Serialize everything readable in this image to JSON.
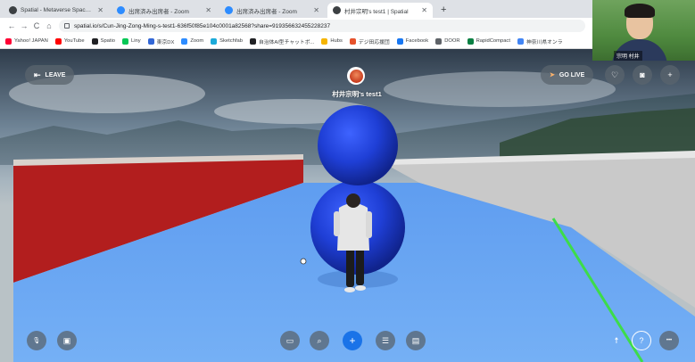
{
  "browser": {
    "tabs": [
      {
        "title": "Spatial - Metaverse Spaces That",
        "favicon_color": "#3c4043"
      },
      {
        "title": "出席済み出席者 - Zoom",
        "favicon_color": "#2d8cff"
      },
      {
        "title": "出席済み出席者 - Zoom",
        "favicon_color": "#2d8cff"
      },
      {
        "title": "村井宗明's test1 | Spatial",
        "favicon_color": "#3c4043",
        "active": true
      }
    ],
    "new_tab_label": "+",
    "url": "spatial.io/s/Cun-Jing-Zong-Ming-s-test1-636f50f85e104c0001a82568?share=919356632455228237",
    "bookmarks": [
      {
        "label": "Yahoo! JAPAN",
        "color": "#ff0033"
      },
      {
        "label": "YouTube",
        "color": "#ff0000"
      },
      {
        "label": "Spatio",
        "color": "#202124"
      },
      {
        "label": "Liny",
        "color": "#06c755"
      },
      {
        "label": "東京DX",
        "color": "#3367d6"
      },
      {
        "label": "Zoom",
        "color": "#2d8cff"
      },
      {
        "label": "Sketchfab",
        "color": "#1caad9"
      },
      {
        "label": "自治体AI型チャットボ...",
        "color": "#202124"
      },
      {
        "label": "Hubs",
        "color": "#f5b400"
      },
      {
        "label": "デジ田応援団",
        "color": "#e6522c"
      },
      {
        "label": "Facebook",
        "color": "#1877f2"
      },
      {
        "label": "DOOR",
        "color": "#5f6368"
      },
      {
        "label": "RapidCompact",
        "color": "#0b8043"
      },
      {
        "label": "神奈川県オンラ",
        "color": "#4285f4"
      }
    ]
  },
  "webcam": {
    "name": "宗明 村井"
  },
  "space": {
    "leave_label": "LEAVE",
    "go_live_label": "GO LIVE",
    "user_name": "村井宗明's test1"
  },
  "icons": {
    "back": "←",
    "forward": "→",
    "reload": "C",
    "home": "⌂",
    "share": "⇪",
    "star": "☆",
    "leave": "⇤",
    "golive": "➤",
    "heart": "♡",
    "camera": "◙",
    "invite": "+",
    "mic_off": "🎙",
    "cam_off": "▣",
    "screen": "▭",
    "search": "⌕",
    "add": "+",
    "emote": "☰",
    "message": "▤",
    "accessibility": "☨",
    "help": "?",
    "more": "•••"
  },
  "colors": {
    "accent": "#1a73e8",
    "sphere": "#1f3fd6",
    "floor": "#6aa4f0",
    "wall_red": "#b21e1e",
    "edge_green": "#3ddc4a"
  }
}
